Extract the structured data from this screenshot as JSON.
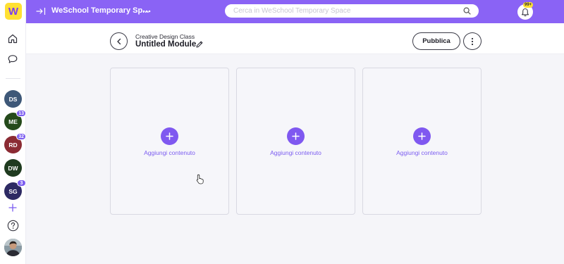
{
  "topbar": {
    "space_title": "WeSchool Temporary Sp...",
    "search_placeholder": "Cerca in WeSchool Temporary Space",
    "notifications_count": "99+"
  },
  "sidebar": {
    "logo_letter": "W",
    "spaces": [
      {
        "initials": "DS",
        "color": "#3e5878",
        "badge": ""
      },
      {
        "initials": "ME",
        "color": "#254a1b",
        "badge": "13"
      },
      {
        "initials": "RD",
        "color": "#8b2b33",
        "badge": "32"
      },
      {
        "initials": "DW",
        "color": "#1f3b1f",
        "badge": ""
      },
      {
        "initials": "SG",
        "color": "#2d2a63",
        "badge": "3"
      }
    ]
  },
  "header": {
    "class_name": "Creative Design Class",
    "module_title": "Untitled Module",
    "publish_label": "Pubblica"
  },
  "content_boxes": [
    {
      "add_label": "Aggiungi contenuto"
    },
    {
      "add_label": "Aggiungi contenuto"
    },
    {
      "add_label": "Aggiungi contenuto"
    }
  ],
  "colors": {
    "accent": "#8a63f5",
    "logo_bg": "#ffe033"
  }
}
